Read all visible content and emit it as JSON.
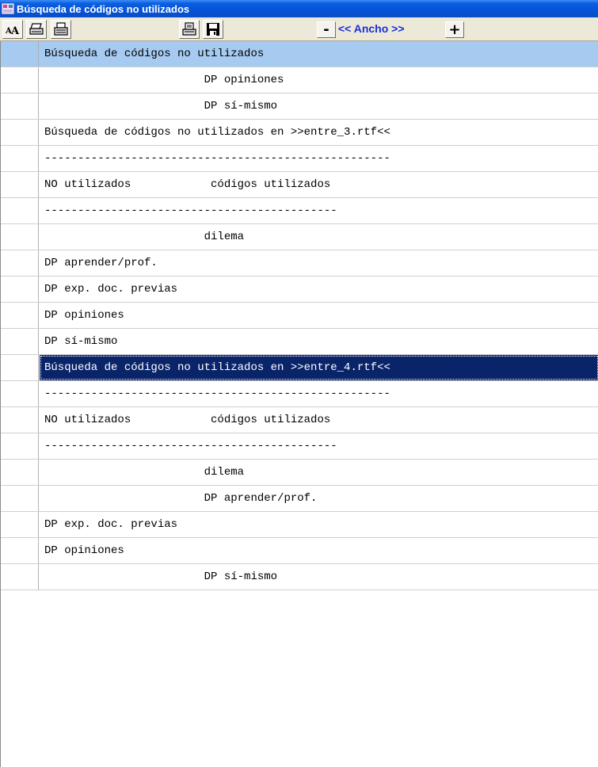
{
  "window": {
    "title": "Búsqueda de códigos no utilizados"
  },
  "toolbar": {
    "minus_label": "-",
    "ancho_label": "<< Ancho >>",
    "plus_label": "+",
    "icons": [
      "font-size-icon",
      "print-icon",
      "print-setup-icon",
      "print-preview-icon",
      "save-icon"
    ]
  },
  "rows": [
    {
      "text": "Búsqueda de códigos no utilizados",
      "style": "header"
    },
    {
      "text": "                        DP opiniones",
      "style": "normal"
    },
    {
      "text": "                        DP sí-mismo",
      "style": "normal"
    },
    {
      "text": "Búsqueda de códigos no utilizados en >>entre_3.rtf<<",
      "style": "normal"
    },
    {
      "text": "----------------------------------------------------",
      "style": "normal"
    },
    {
      "text": "NO utilizados            códigos utilizados",
      "style": "normal"
    },
    {
      "text": "--------------------------------------------",
      "style": "normal"
    },
    {
      "text": "                        dilema",
      "style": "normal"
    },
    {
      "text": "DP aprender/prof.",
      "style": "normal"
    },
    {
      "text": "DP exp. doc. previas",
      "style": "normal"
    },
    {
      "text": "DP opiniones",
      "style": "normal"
    },
    {
      "text": "DP sí-mismo",
      "style": "normal"
    },
    {
      "text": "Búsqueda de códigos no utilizados en >>entre_4.rtf<<",
      "style": "selected"
    },
    {
      "text": "----------------------------------------------------",
      "style": "normal"
    },
    {
      "text": "NO utilizados            códigos utilizados",
      "style": "normal"
    },
    {
      "text": "--------------------------------------------",
      "style": "normal"
    },
    {
      "text": "                        dilema",
      "style": "normal"
    },
    {
      "text": "                        DP aprender/prof.",
      "style": "normal"
    },
    {
      "text": "DP exp. doc. previas",
      "style": "normal"
    },
    {
      "text": "DP opiniones",
      "style": "normal"
    },
    {
      "text": "                        DP sí-mismo",
      "style": "normal"
    }
  ],
  "colors": {
    "header_row": "#a6caf0",
    "selected_row": "#0a246a",
    "ancho_text": "#1b2fd6"
  }
}
